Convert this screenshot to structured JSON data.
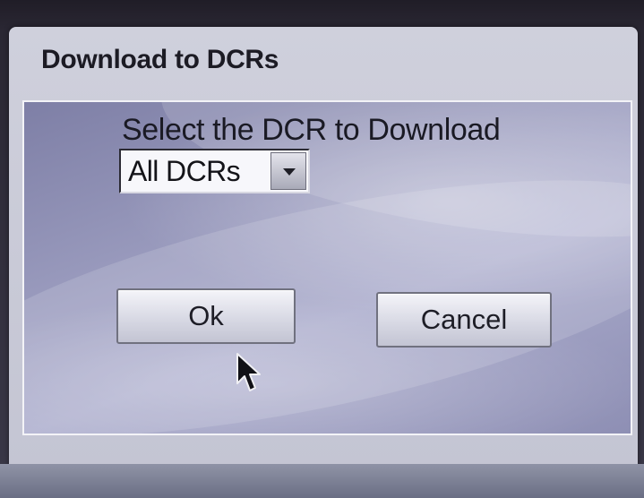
{
  "dialog": {
    "title": "Download to DCRs",
    "prompt": "Select the DCR to Download",
    "dcr_select": {
      "value": "All DCRs"
    },
    "buttons": {
      "ok": "Ok",
      "cancel": "Cancel"
    }
  },
  "colors": {
    "dialog_background": "#c8c9d6",
    "client_area": "#9899bc",
    "button_face": "#e2e3ec",
    "text": "#1c1b24"
  }
}
